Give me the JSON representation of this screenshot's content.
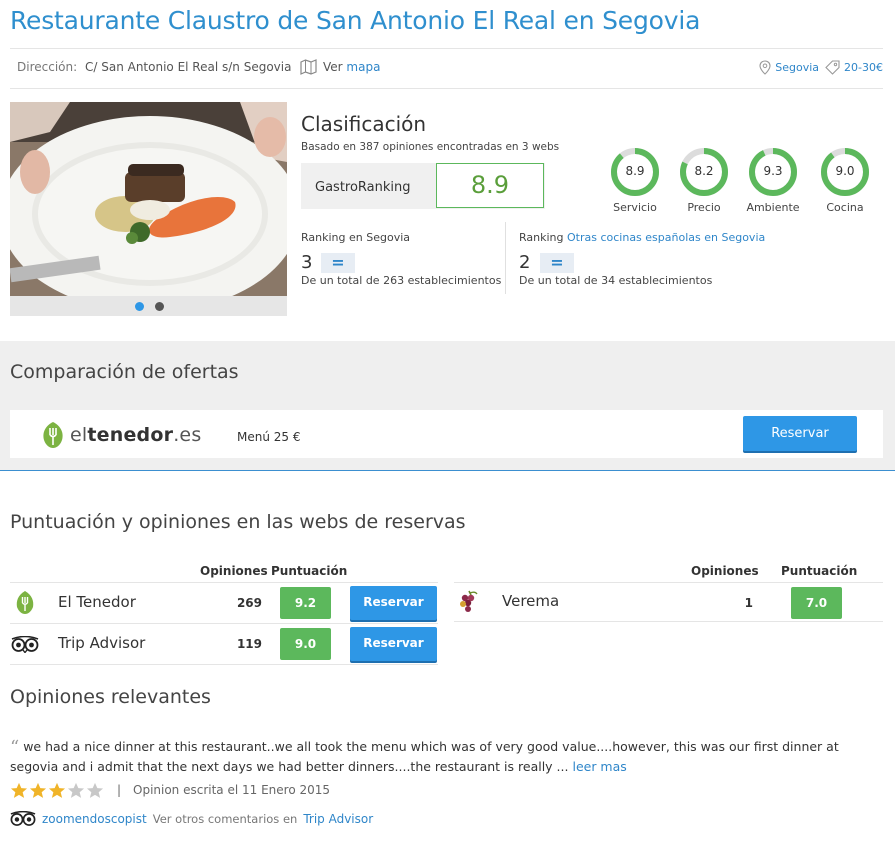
{
  "restaurant": {
    "title": "Restaurante Claustro de San Antonio El Real en Segovia",
    "address_label": "Dirección:",
    "address": "C/ San Antonio El Real s/n Segovia",
    "map_prefix": "Ver",
    "map_link": "mapa",
    "city_tag": "Segovia",
    "price_tag": "20-30€"
  },
  "gallery": {
    "dots": [
      "active",
      "inactive"
    ],
    "colors": {
      "active": "#2e97e6",
      "inactive": "#555555"
    }
  },
  "classification": {
    "title": "Clasificación",
    "subtitle": "Basado en 387 opiniones encontradas en 3 webs",
    "gastro_label": "GastroRanking",
    "gastro_score": "8.9",
    "ratings": [
      {
        "value": "8.9",
        "label": "Servicio",
        "fraction": 0.89
      },
      {
        "value": "8.2",
        "label": "Precio",
        "fraction": 0.82
      },
      {
        "value": "9.3",
        "label": "Ambiente",
        "fraction": 0.93
      },
      {
        "value": "9.0",
        "label": "Cocina",
        "fraction": 0.9
      }
    ],
    "ranking_city": {
      "label": "Ranking en Segovia",
      "position": "3",
      "trend": "=",
      "total": "De un total de 263 establecimientos"
    },
    "ranking_category": {
      "label_prefix": "Ranking",
      "label_link": "Otras cocinas españolas en Segovia",
      "position": "2",
      "trend": "=",
      "total": "De un total de 34 establecimientos"
    }
  },
  "offers": {
    "title": "Comparación de ofertas",
    "provider_prefix": "el",
    "provider_bold": "tenedor",
    "provider_suffix": ".es",
    "menu": "Menú 25 €",
    "button": "Reservar"
  },
  "booking_sites": {
    "title": "Puntuación y opiniones en las webs de reservas",
    "col_opinions": "Opiniones",
    "col_score": "Puntuación",
    "left": [
      {
        "icon": "fork-icon",
        "name": "El Tenedor",
        "opinions": "269",
        "score": "9.2",
        "button": "Reservar"
      },
      {
        "icon": "owl-eyes-icon",
        "name": "Trip Advisor",
        "opinions": "119",
        "score": "9.0",
        "button": "Reservar"
      }
    ],
    "right": [
      {
        "icon": "grapes-icon",
        "name": "Verema",
        "opinions": "1",
        "score": "7.0"
      }
    ]
  },
  "reviews": {
    "title": "Opiniones relevantes",
    "quote_mark": "“",
    "text": "we had a nice dinner at this restaurant..we all took the menu which was of very good value....however, this was our first dinner at segovia and i admit that the next days we had better dinners....the restaurant is really ...",
    "more": "leer mas",
    "stars": 3,
    "stars_max": 5,
    "separator": "|",
    "date": "Opinion escrita el 11 Enero 2015",
    "author": "zoomendoscopist",
    "other_prefix": "Ver otros comentarios en",
    "other_link": "Trip Advisor"
  },
  "colors": {
    "accent_blue": "#2f8fce",
    "score_green": "#5cb85c",
    "star_gold": "#f0b429",
    "star_grey": "#c8c8c8"
  }
}
